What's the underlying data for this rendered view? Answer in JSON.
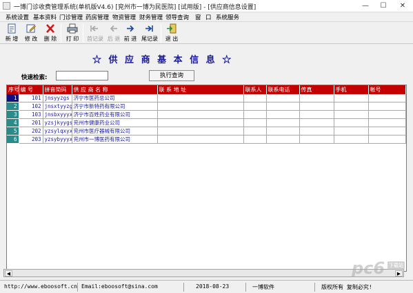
{
  "window": {
    "title": "一博门诊收费管理系统(单机版V4.6)  [兖州市一博为民医院] [试用版] - [供应商信息设置]",
    "min_glyph": "—",
    "max_glyph": "☐",
    "close_glyph": "✕"
  },
  "menu": [
    "系统设置",
    "基本资料",
    "门诊管理",
    "药房管理",
    "物资管理",
    "财务管理",
    "领导查询",
    "窗",
    "口",
    "系统服务"
  ],
  "toolbar": {
    "new": "新 增",
    "edit": "修 改",
    "delete": "删 除",
    "print": "打 印",
    "first": "首记录",
    "prev": "后 退",
    "next": "前 进",
    "last": "尾记录",
    "exit": "退 出"
  },
  "form": {
    "heading": "☆ 供 应 商 基 本 信 息 ☆",
    "search_label": "快速检索:",
    "search_value": "",
    "query_button": "执行查询"
  },
  "table": {
    "columns": [
      "序号",
      "编 号",
      "拼音简码",
      "供 应 商 名 称",
      "联 系 地 址",
      "联系人",
      "联系电话",
      "传真",
      "手机",
      "帐号"
    ],
    "rows": [
      {
        "seq": "1",
        "code": "101",
        "pinyin": "jnsyyzgs",
        "name": "济宁市医药总公司",
        "address": "",
        "contact": "",
        "phone": "",
        "fax": "",
        "mobile": "",
        "account": ""
      },
      {
        "seq": "2",
        "code": "102",
        "pinyin": "jnsxtyyzgs",
        "name": "济宁市新特药有限公司",
        "address": "",
        "contact": "",
        "phone": "",
        "fax": "",
        "mobile": "",
        "account": ""
      },
      {
        "seq": "3",
        "code": "103",
        "pinyin": "jnsbxyyyxg",
        "name": "济宁市百姓药业有限公司",
        "address": "",
        "contact": "",
        "phone": "",
        "fax": "",
        "mobile": "",
        "account": ""
      },
      {
        "seq": "4",
        "code": "201",
        "pinyin": "yzsjkyygs",
        "name": "兖州市健康药业公司",
        "address": "",
        "contact": "",
        "phone": "",
        "fax": "",
        "mobile": "",
        "account": ""
      },
      {
        "seq": "5",
        "code": "202",
        "pinyin": "yzsylqxyxg",
        "name": "兖州市医疗器械有限公司",
        "address": "",
        "contact": "",
        "phone": "",
        "fax": "",
        "mobile": "",
        "account": ""
      },
      {
        "seq": "6",
        "code": "203",
        "pinyin": "yzsybyyyxg",
        "name": "兖州市一博医药有限公司",
        "address": "",
        "contact": "",
        "phone": "",
        "fax": "",
        "mobile": "",
        "account": ""
      }
    ],
    "active_row": 0
  },
  "status": {
    "website": "http://www.eboosoft.cn",
    "email": "Email:eboosoft@sina.com",
    "date": "2018-08-23",
    "company": "一博软件",
    "copyright": "版权所有   复制必究!"
  },
  "watermark": {
    "text": "pc6",
    "badge": "下载站"
  },
  "colors": {
    "header_red": "#c40000",
    "heading_blue": "#1a1a9a",
    "row_index_teal": "#2b8a8a",
    "active_row_navy": "#101080",
    "data_blue": "#1a1aa0"
  }
}
